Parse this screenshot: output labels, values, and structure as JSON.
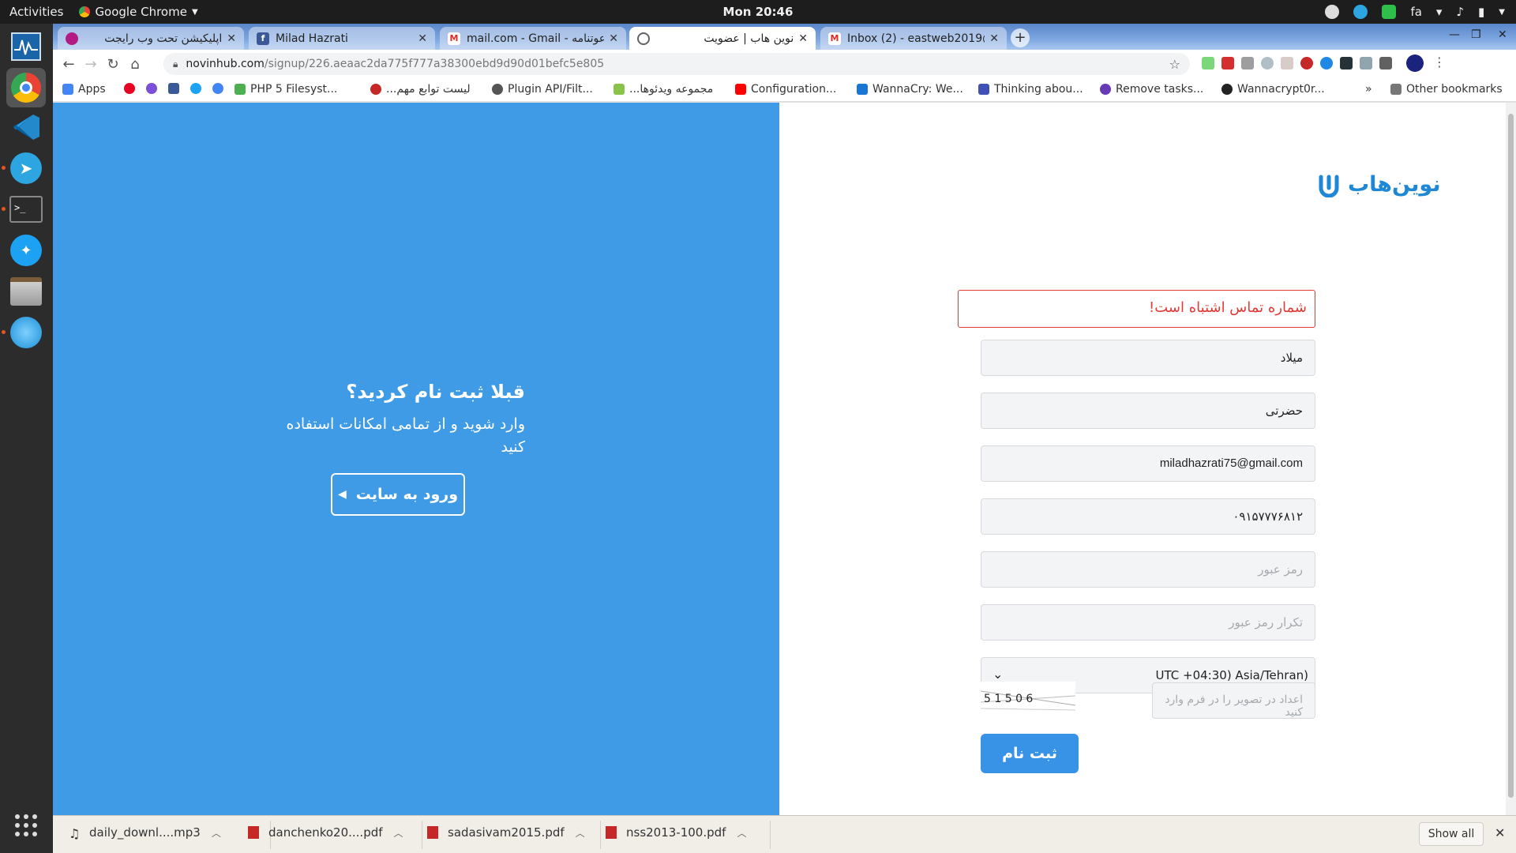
{
  "topbar": {
    "activities": "Activities",
    "app_name": "Google Chrome",
    "clock": "Mon 20:46",
    "lang": "fa"
  },
  "dock": {
    "items": [
      "system-monitor",
      "chrome",
      "vscode",
      "telegram",
      "terminal",
      "twitter",
      "files",
      "app"
    ],
    "apps_grid": "show-applications"
  },
  "tabs": [
    {
      "title": "اپلیکیشن تحت وب رایجت",
      "favicon_color": "#b21b83"
    },
    {
      "title": "Milad Hazrati",
      "favicon_color": "#3b5998"
    },
    {
      "title": "mail.com - Gmail - دعوتنامه",
      "favicon_color": "#d93025"
    },
    {
      "title": "نوین هاب | عضویت",
      "favicon_color": "#5f6368"
    },
    {
      "title": "Inbox (2) - eastweb2019@",
      "favicon_color": "#d93025"
    }
  ],
  "toolbar": {
    "url_host": "novinhub.com",
    "url_path": "/signup/226.aeaac2da775f777a38300ebd9d90d01befc5e805"
  },
  "bookmarks": [
    {
      "label": "Apps",
      "color": "#4285f4"
    },
    {
      "label": "",
      "color": "#e60023"
    },
    {
      "label": "",
      "color": "#7b4fd6"
    },
    {
      "label": "",
      "color": "#3b5998"
    },
    {
      "label": "",
      "color": "#1da1f2"
    },
    {
      "label": "",
      "color": "#4285f4"
    },
    {
      "label": "PHP 5 Filesyst...",
      "color": "#4caf50"
    },
    {
      "label": "لیست توابع مهم...",
      "color": "#c62828"
    },
    {
      "label": "Plugin API/Filt...",
      "color": "#555555"
    },
    {
      "label": "مجموعه ویدئوها...",
      "color": "#8bc34a"
    },
    {
      "label": "Configuration...",
      "color": "#ff0000"
    },
    {
      "label": "WannaCry: We...",
      "color": "#1976d2"
    },
    {
      "label": "Thinking abou...",
      "color": "#3f51b5"
    },
    {
      "label": "Remove tasks...",
      "color": "#673ab7"
    },
    {
      "label": "Wannacrypt0r...",
      "color": "#222222"
    }
  ],
  "bookmarks_more": "»",
  "other_bookmarks": "Other bookmarks",
  "left_panel": {
    "heading": "قبلا ثبت نام کردید؟",
    "description": "وارد شوید و از تمامی امکانات استفاده کنید",
    "login_button": "ورود به سایت",
    "bg_color": "#3f9be6"
  },
  "form": {
    "logo_text": "نوین‌هاب",
    "error": "شماره تماس اشتباه است!",
    "first_name": "میلاد",
    "last_name": "حضرتی",
    "email": "miladhazrati75@gmail.com",
    "phone": "۰۹۱۵۷۷۷۶۸۱۲",
    "password_placeholder": "رمز عبور",
    "password_confirm_placeholder": "تکرار رمز عبور",
    "timezone": "UTC +04:30) Asia/Tehran)",
    "captcha_text": "5 1 5 0 6",
    "captcha_placeholder": "اعداد در تصویر را در فرم وارد کنید",
    "submit": "ثبت نام"
  },
  "downloads": [
    {
      "name": "daily_downl....mp3",
      "icon": "music-icon"
    },
    {
      "name": "danchenko20....pdf",
      "icon": "pdf-icon"
    },
    {
      "name": "sadasivam2015.pdf",
      "icon": "pdf-icon"
    },
    {
      "name": "nss2013-100.pdf",
      "icon": "pdf-icon"
    }
  ],
  "downloads_show_all": "Show all"
}
